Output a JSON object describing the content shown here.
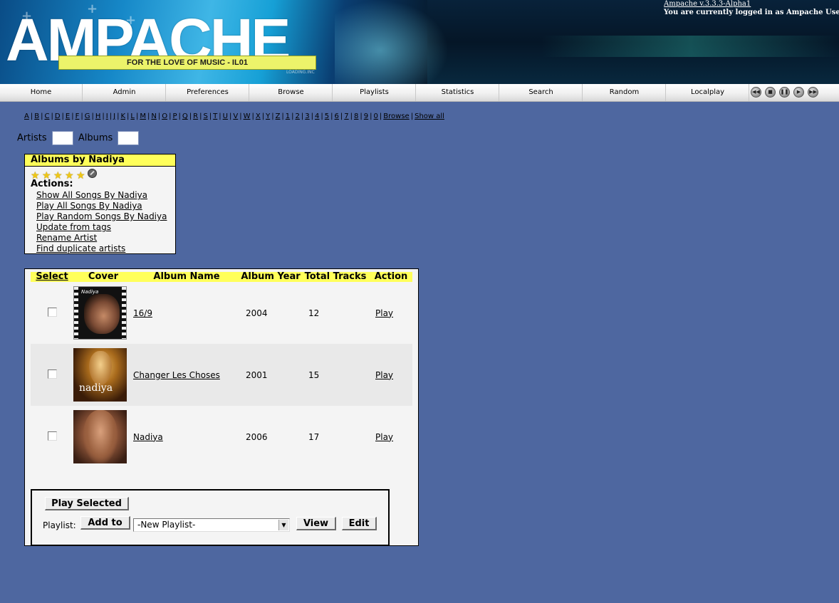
{
  "header": {
    "logo_text": "AMPACHE",
    "tagline": "FOR THE LOVE OF MUSIC - IL01",
    "watermark": "LOADING.INC",
    "version_link": "Ampache v.3.3.3-Alpha1",
    "logged_in_text": "You are currently logged in as Ampache User"
  },
  "nav": {
    "items": [
      "Home",
      "Admin",
      "Preferences",
      "Browse",
      "Playlists",
      "Statistics",
      "Search",
      "Random",
      "Localplay"
    ],
    "controls": [
      "rewind-icon",
      "stop-icon",
      "pause-icon",
      "play-icon",
      "fast-forward-icon"
    ]
  },
  "alphabet": {
    "letters": [
      "A",
      "B",
      "C",
      "D",
      "E",
      "F",
      "G",
      "H",
      "I",
      "J",
      "K",
      "L",
      "M",
      "N",
      "O",
      "P",
      "Q",
      "R",
      "S",
      "T",
      "U",
      "V",
      "W",
      "X",
      "Y",
      "Z",
      "1",
      "2",
      "3",
      "4",
      "5",
      "6",
      "7",
      "8",
      "9",
      "0"
    ],
    "browse_link": "Browse",
    "show_all_link": "Show all"
  },
  "search": {
    "artists_label": "Artists",
    "albums_label": "Albums"
  },
  "info_box": {
    "title": "Albums by Nadiya",
    "rating": 5,
    "rating_max": 5,
    "actions_label": "Actions:",
    "actions": [
      "Show All Songs By Nadiya",
      "Play All Songs By Nadiya",
      "Play Random Songs By Nadiya",
      "Update from tags",
      "Rename Artist",
      "Find duplicate artists"
    ]
  },
  "albums": {
    "headers": {
      "select": "Select",
      "cover": "Cover",
      "name": "Album Name",
      "year": "Album Year",
      "tracks": "Total Tracks",
      "action": "Action"
    },
    "rows": [
      {
        "name": "16/9",
        "year": "2004",
        "tracks": "12",
        "action": "Play"
      },
      {
        "name": "Changer Les Choses",
        "year": "2001",
        "tracks": "15",
        "action": "Play"
      },
      {
        "name": "Nadiya",
        "year": "2006",
        "tracks": "17",
        "action": "Play"
      }
    ]
  },
  "form": {
    "play_selected": "Play Selected",
    "playlist_label": "Playlist:",
    "add_to": "Add to",
    "playlist_option": "-New Playlist-",
    "view": "View",
    "edit": "Edit"
  },
  "colors": {
    "page_background": "#4e67a0",
    "title_bar": "#ffff5a",
    "box_background": "#f4f4f4"
  }
}
